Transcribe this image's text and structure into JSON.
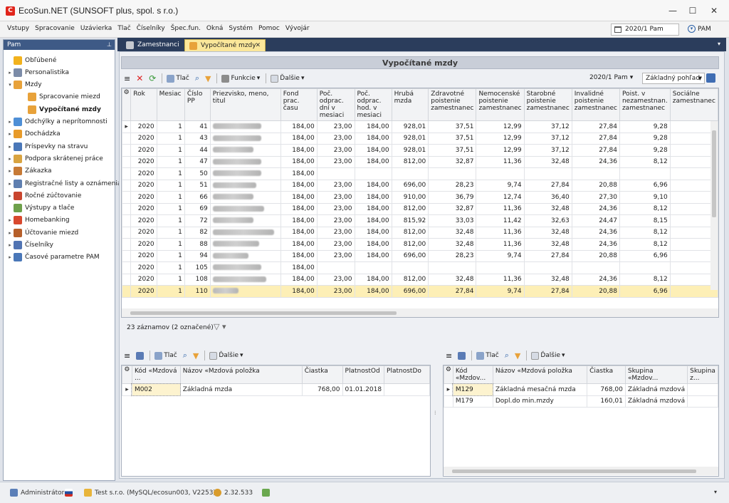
{
  "window": {
    "title": "EcoSun.NET  (SUNSOFT plus, spol. s r.o.)",
    "logo_letter": "C"
  },
  "menu": [
    "Vstupy",
    "Spracovanie",
    "Uzávierka",
    "Tlač",
    "Číselníky",
    "Špec.fun.",
    "Okná",
    "Systém",
    "Pomoc",
    "Vývojár"
  ],
  "period_box": "2020/1 Pam",
  "pam_label": "PAM",
  "nav": {
    "header": "Pam",
    "items": [
      {
        "label": "Obľúbené",
        "level": 0,
        "arrow": "",
        "color": "#f2b21d"
      },
      {
        "label": "Personalistika",
        "level": 0,
        "arrow": "▸",
        "color": "#7c8ca8"
      },
      {
        "label": "Mzdy",
        "level": 0,
        "arrow": "▾",
        "color": "#e8a23a"
      },
      {
        "label": "Spracovanie miezd",
        "level": 1,
        "arrow": "",
        "color": "#e8a23a"
      },
      {
        "label": "Vypočítané mzdy",
        "level": 1,
        "arrow": "",
        "color": "#e8a23a",
        "bold": true
      },
      {
        "label": "Odchýlky a neprítomnosti",
        "level": 0,
        "arrow": "▸",
        "color": "#4e8fd6"
      },
      {
        "label": "Dochádzka",
        "level": 0,
        "arrow": "▸",
        "color": "#e89b2a"
      },
      {
        "label": "Príspevky na stravu",
        "level": 0,
        "arrow": "▸",
        "color": "#4a77b8"
      },
      {
        "label": "Podpora skrátenej práce",
        "level": 0,
        "arrow": "▸",
        "color": "#d9a441"
      },
      {
        "label": "Zákazka",
        "level": 0,
        "arrow": "▸",
        "color": "#c77a36"
      },
      {
        "label": "Registračné listy a oznámenia",
        "level": 0,
        "arrow": "▸",
        "color": "#5f7fb0"
      },
      {
        "label": "Ročné zúčtovanie",
        "level": 0,
        "arrow": "▸",
        "color": "#c9452e"
      },
      {
        "label": "Výstupy a tlače",
        "level": 0,
        "arrow": "",
        "color": "#6ea04b"
      },
      {
        "label": "Homebanking",
        "level": 0,
        "arrow": "▸",
        "color": "#d8482e"
      },
      {
        "label": "Účtovanie miezd",
        "level": 0,
        "arrow": "▸",
        "color": "#b65f2a"
      },
      {
        "label": "Číselníky",
        "level": 0,
        "arrow": "▸",
        "color": "#5174b3"
      },
      {
        "label": "Časové parametre PAM",
        "level": 0,
        "arrow": "▸",
        "color": "#4a77b8"
      }
    ]
  },
  "tabs": [
    {
      "label": "Zamestnanci"
    },
    {
      "label": "Vypočítané mzdy"
    }
  ],
  "content_title": "Vypočítané mzdy",
  "toolbar": {
    "print": "Tlač",
    "functions": "Funkcie",
    "more": "Ďalšie",
    "period": "2020/1 Pam",
    "view": "Základný pohľad"
  },
  "grid": {
    "columns": [
      "Rok",
      "Mesiac",
      "Číslo PP",
      "Priezvisko, meno, titul",
      "Fond prac. času",
      "Poč. odprac. dní v mesiaci",
      "Poč. odprac. hod. v mesiaci",
      "Hrubá mzda",
      "Zdravotné poistenie zamestnanec",
      "Nemocenské poistenie zamestnanec",
      "Starobné poistenie zamestnanec",
      "Invalidné poistenie zamestnanec",
      "Poist. v nezamestnan. zamestnanec",
      "Sociálne zamestnanec"
    ],
    "rows": [
      [
        "2020",
        "1",
        "41",
        "Škrabala Jozef Ing.",
        "184,00",
        "23,00",
        "184,00",
        "928,01",
        "37,51",
        "12,99",
        "37,12",
        "27,84",
        "9,28"
      ],
      [
        "2020",
        "1",
        "43",
        "Kustra Norbert Ing.",
        "184,00",
        "23,00",
        "184,00",
        "928,01",
        "37,51",
        "12,99",
        "37,12",
        "27,84",
        "9,28"
      ],
      [
        "2020",
        "1",
        "44",
        "Bartók Ivan Ing.",
        "184,00",
        "23,00",
        "184,00",
        "928,01",
        "37,51",
        "12,99",
        "37,12",
        "27,84",
        "9,28"
      ],
      [
        "2020",
        "1",
        "47",
        "Dušeková Ivana Ing.",
        "184,00",
        "23,00",
        "184,00",
        "812,00",
        "32,87",
        "11,36",
        "32,48",
        "24,36",
        "8,12"
      ],
      [
        "2020",
        "1",
        "50",
        "Mirosla Dragan Ing.",
        "184,00",
        "",
        "",
        "",
        "",
        "",
        "",
        "",
        ""
      ],
      [
        "2020",
        "1",
        "51",
        "Tichoňová Adriana",
        "184,00",
        "23,00",
        "184,00",
        "696,00",
        "28,23",
        "9,74",
        "27,84",
        "20,88",
        "6,96"
      ],
      [
        "2020",
        "1",
        "66",
        "Dolešal Ján Ing.",
        "184,00",
        "23,00",
        "184,00",
        "910,00",
        "36,79",
        "12,74",
        "36,40",
        "27,30",
        "9,10"
      ],
      [
        "2020",
        "1",
        "69",
        "Pučeková Marta RNDr.",
        "184,00",
        "23,00",
        "184,00",
        "812,00",
        "32,87",
        "11,36",
        "32,48",
        "24,36",
        "8,12"
      ],
      [
        "2020",
        "1",
        "72",
        "Matúšová Ľudmila",
        "184,00",
        "23,00",
        "184,00",
        "815,92",
        "33,03",
        "11,42",
        "32,63",
        "24,47",
        "8,15"
      ],
      [
        "2020",
        "1",
        "82",
        "Valentíny František Mgr.",
        "184,00",
        "23,00",
        "184,00",
        "812,00",
        "32,48",
        "11,36",
        "32,48",
        "24,36",
        "8,12"
      ],
      [
        "2020",
        "1",
        "88",
        "Pavel Capulak Ing.",
        "184,00",
        "23,00",
        "184,00",
        "812,00",
        "32,48",
        "11,36",
        "32,48",
        "24,36",
        "8,12"
      ],
      [
        "2020",
        "1",
        "94",
        "Benenčík Lukáš",
        "184,00",
        "23,00",
        "184,00",
        "696,00",
        "28,23",
        "9,74",
        "27,84",
        "20,88",
        "6,96"
      ],
      [
        "2020",
        "1",
        "105",
        "Majchrák Pavol Ing.",
        "184,00",
        "",
        "",
        "",
        "",
        "",
        "",
        "",
        ""
      ],
      [
        "2020",
        "1",
        "108",
        "Obořová Katarína Ing.",
        "184,00",
        "23,00",
        "184,00",
        "812,00",
        "32,48",
        "11,36",
        "32,48",
        "24,36",
        "8,12"
      ],
      [
        "2020",
        "1",
        "110",
        "Fiala Ivan",
        "184,00",
        "23,00",
        "184,00",
        "696,00",
        "27,84",
        "9,74",
        "27,84",
        "20,88",
        "6,96"
      ]
    ],
    "selected_row": 14,
    "current_row": 0
  },
  "record_count": "23 záznamov  (2 označené)",
  "left_panel": {
    "columns": [
      "Kód «Mzdová ...",
      "Názov «Mzdová položka",
      "Čiastka",
      "PlatnostOd",
      "PlatnostDo"
    ],
    "rows": [
      [
        "M002",
        "Základná mzda",
        "768,00",
        "01.01.2018",
        ""
      ]
    ]
  },
  "right_panel": {
    "columns": [
      "Kód «Mzdov...",
      "Názov «Mzdová položka",
      "Čiastka",
      "Skupina «Mzdov...",
      "Skupina z..."
    ],
    "rows": [
      [
        "M129",
        "Základná mesačná mzda",
        "768,00",
        "Základná mzdová",
        ""
      ],
      [
        "M179",
        "Dopl.do min.mzdy",
        "160,01",
        "Základná mzdová",
        ""
      ]
    ]
  },
  "status": {
    "user": "Administrátor",
    "database": "Test s.r.o. (MySQL/ecosun003, V2253)",
    "version": "2.32.533"
  }
}
